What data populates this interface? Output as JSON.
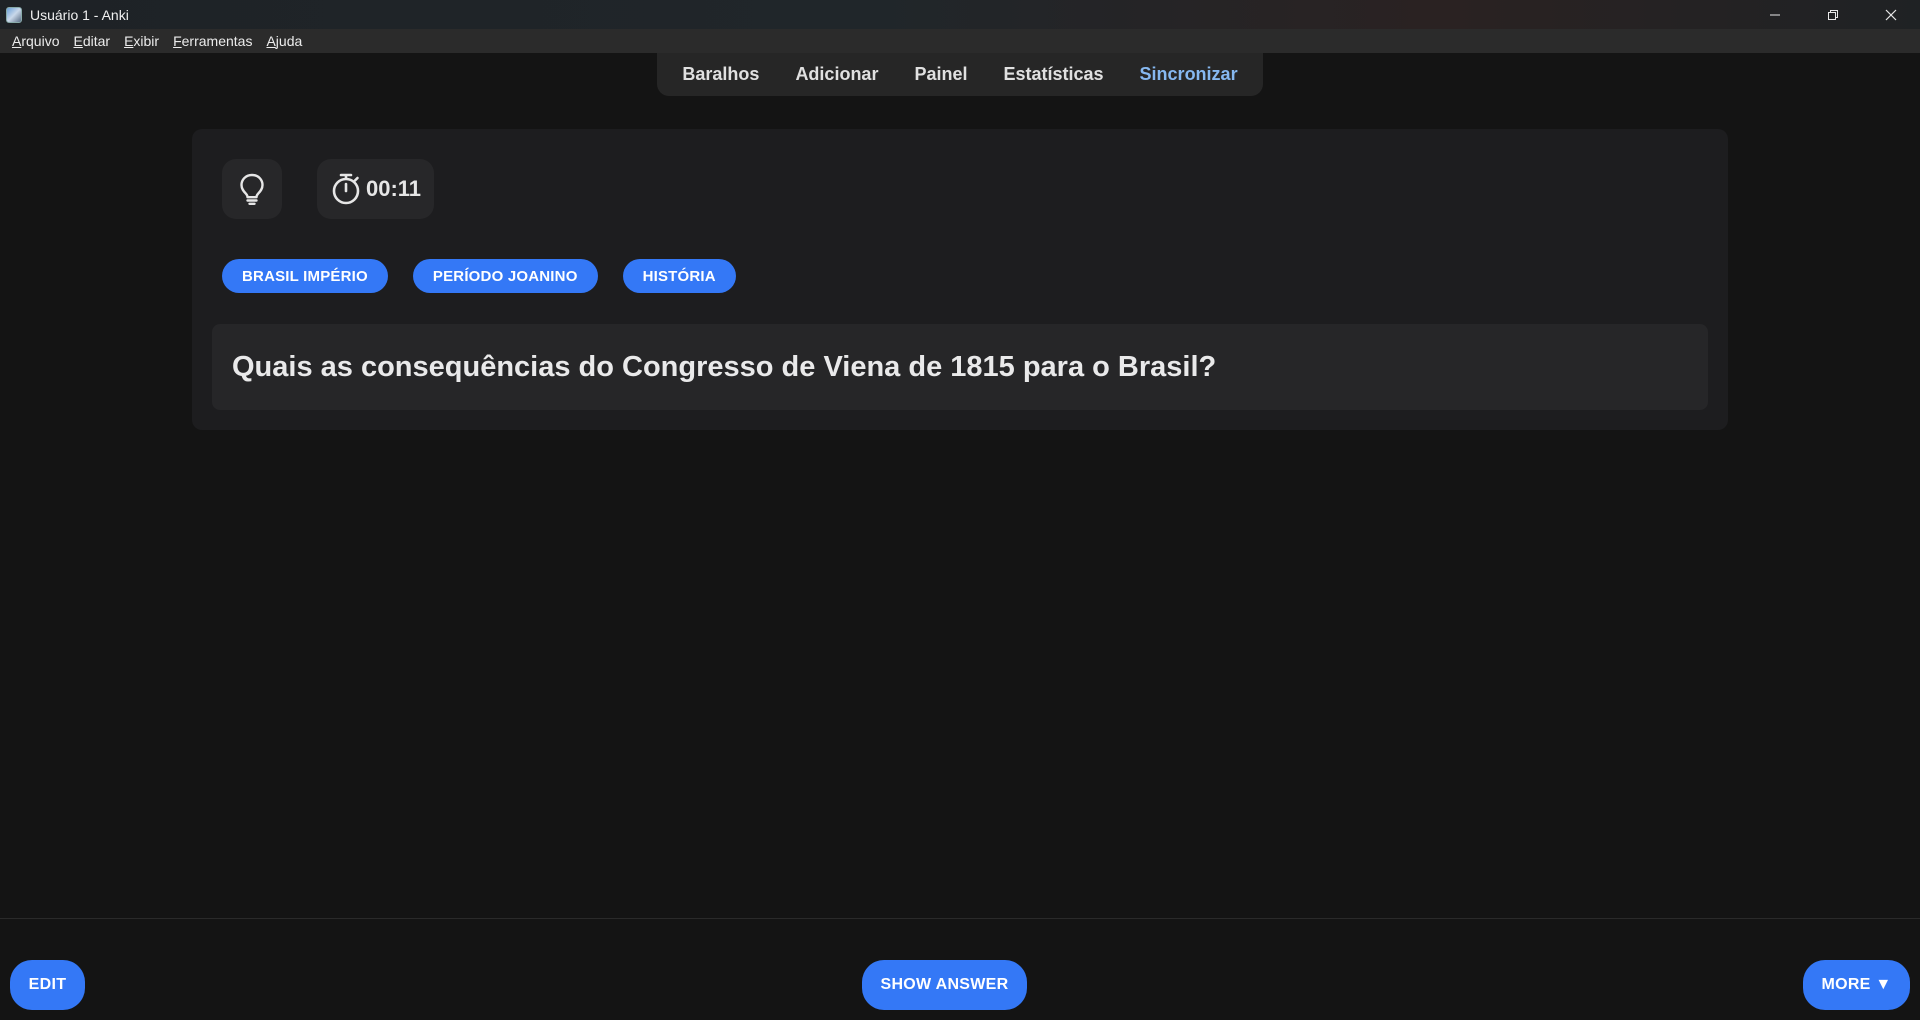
{
  "window": {
    "title": "Usuário 1 - Anki",
    "controls": [
      "minimize-icon",
      "restore-icon",
      "close-icon"
    ]
  },
  "menubar": {
    "items": [
      {
        "first": "A",
        "rest": "rquivo"
      },
      {
        "first": "E",
        "rest": "ditar"
      },
      {
        "first": "E",
        "rest": "xibir"
      },
      {
        "first": "F",
        "rest": "erramentas"
      },
      {
        "first": "A",
        "rest": "juda"
      }
    ]
  },
  "toolbar": {
    "decks": "Baralhos",
    "add": "Adicionar",
    "browse": "Painel",
    "stats": "Estatísticas",
    "sync": "Sincronizar",
    "sync_color": "#86b8f0"
  },
  "card": {
    "hint_icon": "lightbulb-icon",
    "timer_icon": "stopwatch-icon",
    "timer": "00:11",
    "tags": [
      "BRASIL IMPÉRIO",
      "PERÍODO JOANINO",
      "HISTÓRIA"
    ],
    "question": "Quais as consequências do Congresso de Viena de 1815 para o Brasil?",
    "tag_color": "#3478f6"
  },
  "bottom": {
    "edit": "EDIT",
    "show_answer": "SHOW ANSWER",
    "more": "MORE ▼",
    "button_color": "#3478f6"
  }
}
